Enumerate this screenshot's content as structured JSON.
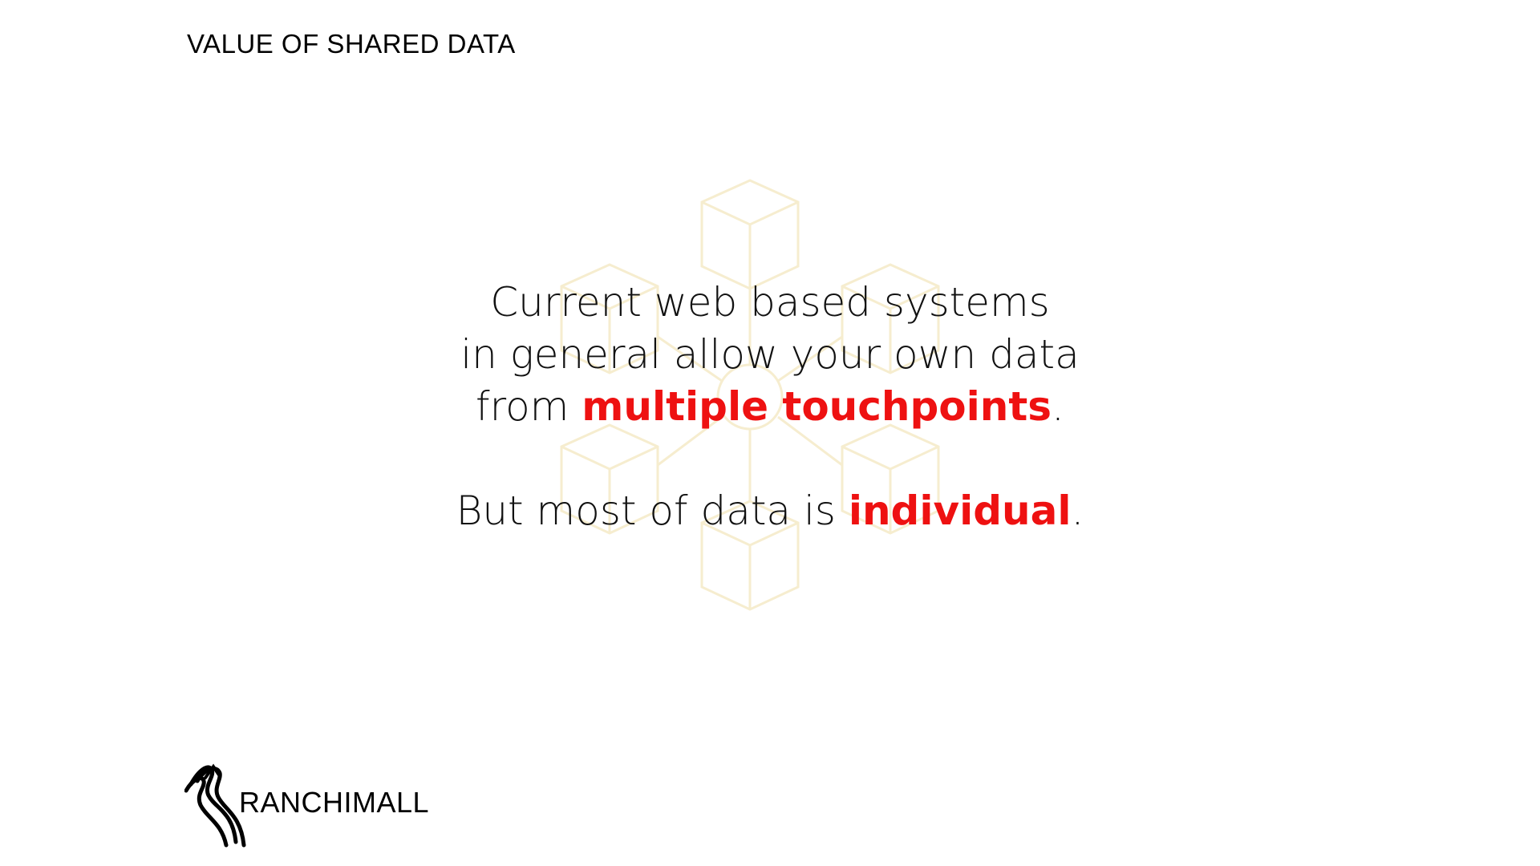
{
  "slide": {
    "title": "VALUE OF SHARED DATA"
  },
  "message": {
    "line1": "Current web based systems",
    "line2": "in general allow your own data",
    "line3_prefix": "from ",
    "line3_highlight": "multiple touchpoints",
    "line3_suffix": ".",
    "line4_prefix": "But most of data is ",
    "line4_highlight": "individual",
    "line4_suffix": "."
  },
  "logo": {
    "text": "RANCHIMALL"
  },
  "colors": {
    "highlight": "#ee1111",
    "watermark": "#f6edcf",
    "text": "#111111"
  },
  "icons": {
    "watermark": "cube-network-icon",
    "logo_mark": "ranchimall-logo-icon"
  }
}
